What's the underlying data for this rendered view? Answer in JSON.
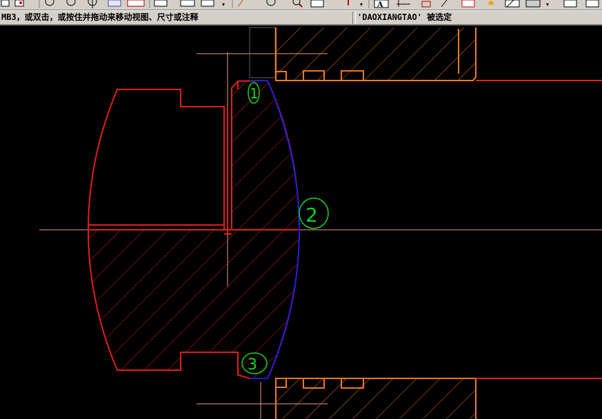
{
  "status_bar": {
    "prompt_text": "MB3，或双击，或按住并拖动来移动视图、尺寸或注释",
    "selection_text": "'DAOXIANGTAO' 被选定"
  },
  "annotations": {
    "mark_1": "1",
    "mark_2": "2",
    "mark_3": "3"
  },
  "colors": {
    "background": "#000000",
    "part_red": "#e0201c",
    "housing_orange": "#f07a20",
    "arc_blue": "#1c1cd8",
    "annotation_green": "#19d41e",
    "centerline": "#e8a080"
  },
  "toolbar_icons": [
    "new-file-icon",
    "open-file-icon",
    "circle-tool-icon",
    "circle-tool-icon",
    "axis-icon",
    "view-icon",
    "grid-icon",
    "table-icon",
    "frame-icon",
    "pen-icon",
    "zoom-icon",
    "page-icon",
    "marker-icon",
    "text-icon",
    "dimension-icon",
    "move-icon",
    "edit-icon",
    "window-icon",
    "star-icon",
    "hatch-icon",
    "iso-view-icon",
    "fold-icon"
  ]
}
